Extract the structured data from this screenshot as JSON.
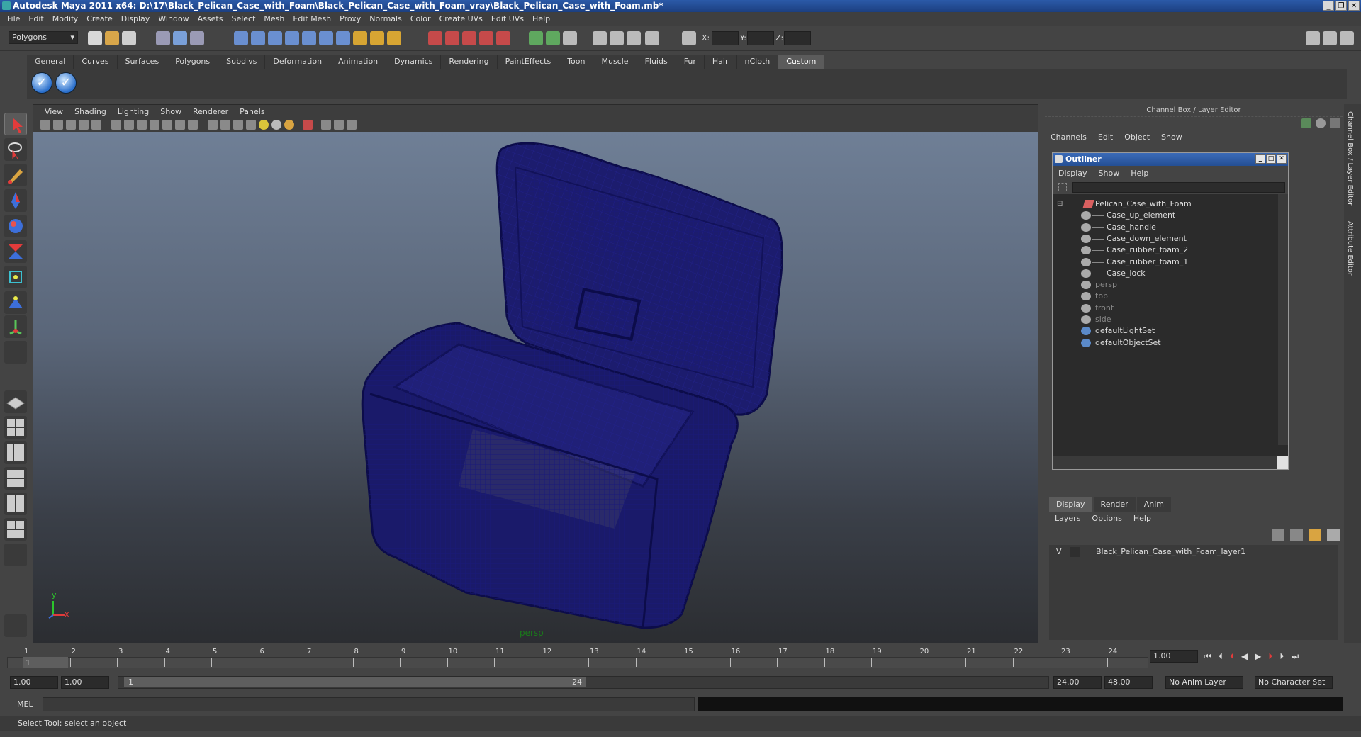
{
  "window": {
    "title": "Autodesk Maya 2011 x64: D:\\17\\Black_Pelican_Case_with_Foam\\Black_Pelican_Case_with_Foam_vray\\Black_Pelican_Case_with_Foam.mb*"
  },
  "menubar": [
    "File",
    "Edit",
    "Modify",
    "Create",
    "Display",
    "Window",
    "Assets",
    "Select",
    "Mesh",
    "Edit Mesh",
    "Proxy",
    "Normals",
    "Color",
    "Create UVs",
    "Edit UVs",
    "Help"
  ],
  "statusline": {
    "mode": "Polygons",
    "x_label": "X:",
    "y_label": "Y:",
    "z_label": "Z:"
  },
  "shelf": {
    "tabs": [
      "General",
      "Curves",
      "Surfaces",
      "Polygons",
      "Subdivs",
      "Deformation",
      "Animation",
      "Dynamics",
      "Rendering",
      "PaintEffects",
      "Toon",
      "Muscle",
      "Fluids",
      "Fur",
      "Hair",
      "nCloth",
      "Custom"
    ],
    "active_tab": "Custom"
  },
  "viewport": {
    "menu": [
      "View",
      "Shading",
      "Lighting",
      "Show",
      "Renderer",
      "Panels"
    ],
    "camera_label": "persp",
    "axis_y": "y",
    "axis_x": "x"
  },
  "channel_box": {
    "header": "Channel Box / Layer Editor",
    "menu": [
      "Channels",
      "Edit",
      "Object",
      "Show"
    ]
  },
  "outliner": {
    "title": "Outliner",
    "menu": [
      "Display",
      "Show",
      "Help"
    ],
    "items": [
      {
        "label": "Pelican_Case_with_Foam",
        "level": 0,
        "dim": false
      },
      {
        "label": "Case_up_element",
        "level": 1,
        "dim": false
      },
      {
        "label": "Case_handle",
        "level": 1,
        "dim": false
      },
      {
        "label": "Case_down_element",
        "level": 1,
        "dim": false
      },
      {
        "label": "Case_rubber_foam_2",
        "level": 1,
        "dim": false
      },
      {
        "label": "Case_rubber_foam_1",
        "level": 1,
        "dim": false
      },
      {
        "label": "Case_lock",
        "level": 1,
        "dim": false
      },
      {
        "label": "persp",
        "level": 0,
        "dim": true
      },
      {
        "label": "top",
        "level": 0,
        "dim": true
      },
      {
        "label": "front",
        "level": 0,
        "dim": true
      },
      {
        "label": "side",
        "level": 0,
        "dim": true
      },
      {
        "label": "defaultLightSet",
        "level": 0,
        "dim": false
      },
      {
        "label": "defaultObjectSet",
        "level": 0,
        "dim": false
      }
    ]
  },
  "layer_editor": {
    "tabs": [
      "Display",
      "Render",
      "Anim"
    ],
    "active_tab": "Display",
    "menu": [
      "Layers",
      "Options",
      "Help"
    ],
    "layers": [
      {
        "visible": "V",
        "name": "Black_Pelican_Case_with_Foam_layer1"
      }
    ]
  },
  "side_tabs": [
    "Channel Box / Layer Editor",
    "Attribute Editor"
  ],
  "timeline": {
    "frames": [
      "1",
      "2",
      "3",
      "4",
      "5",
      "6",
      "7",
      "8",
      "9",
      "10",
      "11",
      "12",
      "13",
      "14",
      "15",
      "16",
      "17",
      "18",
      "19",
      "20",
      "21",
      "22",
      "23",
      "24"
    ],
    "current_frame": "1",
    "current_time_field": "1.00"
  },
  "range": {
    "start_time": "1.00",
    "playback_start": "1.00",
    "slider_start": "1",
    "slider_end": "24",
    "playback_end": "24.00",
    "end_time": "48.00",
    "anim_layer": "No Anim Layer",
    "character_set": "No Character Set"
  },
  "command_line": {
    "label": "MEL"
  },
  "status": {
    "help_line": "Select Tool: select an object"
  }
}
